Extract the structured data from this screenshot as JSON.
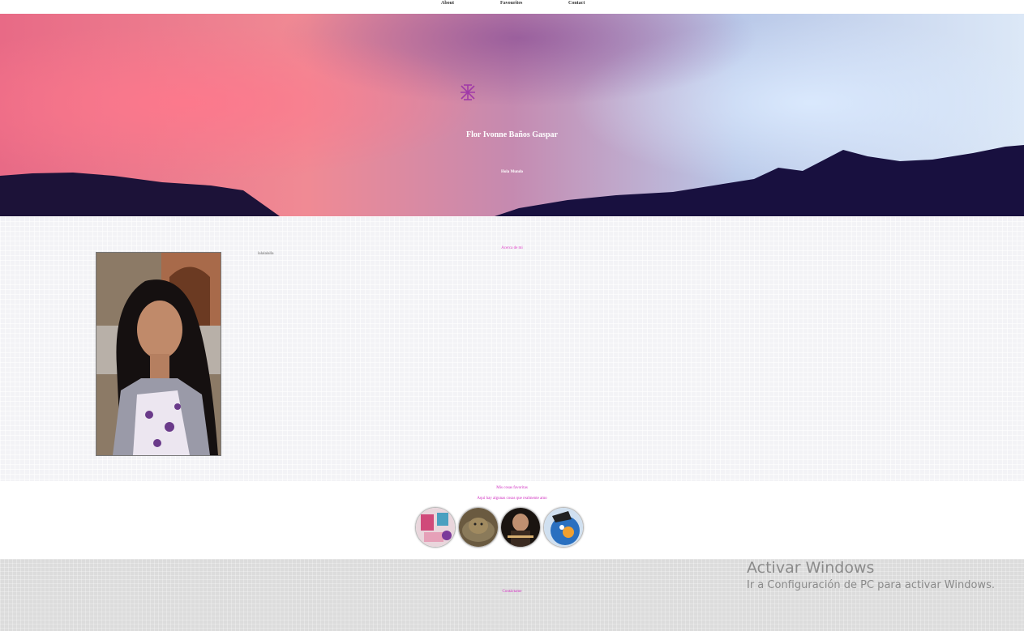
{
  "nav": {
    "items": [
      "About",
      "Favourites",
      "Contact"
    ]
  },
  "hero": {
    "title": "Flor Ivonne Baños Gaspar",
    "subtitle": "Hola Mundo",
    "logo_icon": "purple-star-icon"
  },
  "about": {
    "heading": "Acerca de mi",
    "text": "lalalalalla"
  },
  "favourites": {
    "heading": "Mis cosas favoritas",
    "subheading": "Aquí hay algunas cosas que realmente amo"
  },
  "contact": {
    "heading": "Contáctame"
  },
  "watermark": {
    "title": "Activar Windows",
    "subtitle": "Ir a Configuración de PC para activar Windows."
  },
  "colors": {
    "accent": "#d030c0",
    "mountains": "#1a1040"
  }
}
